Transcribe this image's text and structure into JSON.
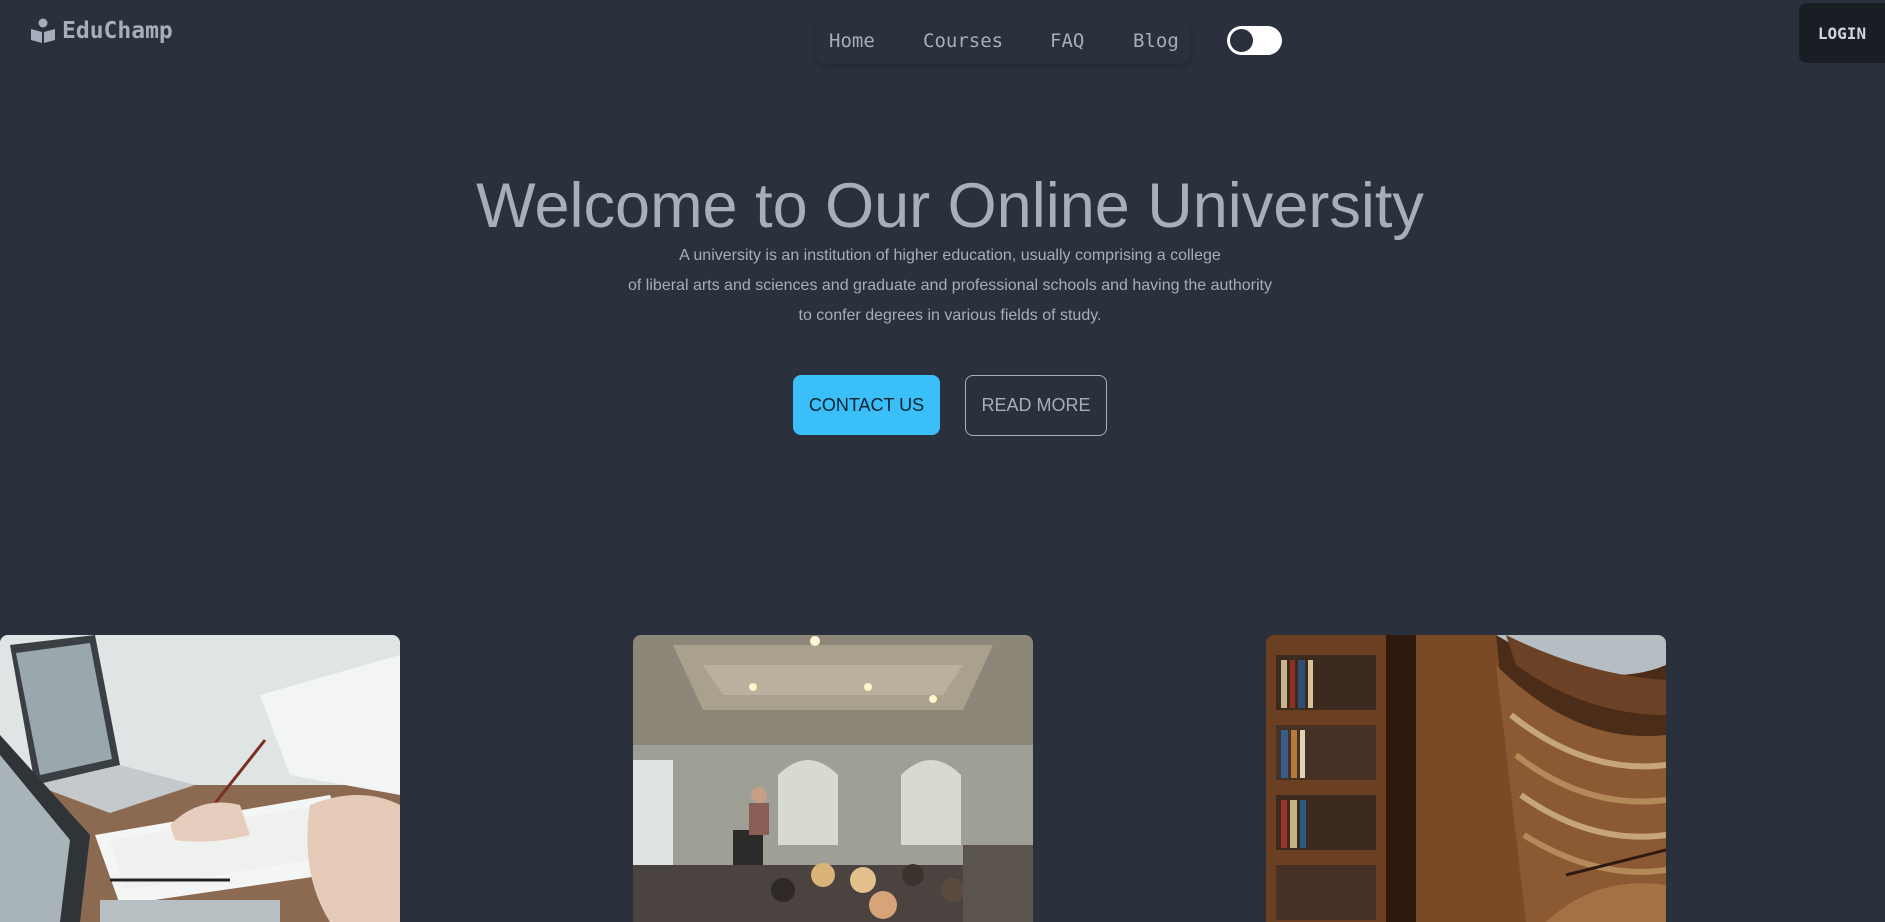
{
  "brand": {
    "name": "EduChamp",
    "icon": "book-reader-icon"
  },
  "nav": {
    "items": [
      {
        "label": "Home"
      },
      {
        "label": "Courses"
      },
      {
        "label": "FAQ"
      },
      {
        "label": "Blog"
      }
    ],
    "theme_toggle": {
      "state": "off"
    },
    "login_label": "LOGIN"
  },
  "hero": {
    "title": "Welcome to Our Online University",
    "description_lines": [
      "A university is an institution of higher education, usually comprising a college",
      "of liberal arts and sciences and graduate and professional schools and having the authority",
      "to confer degrees in various fields of study."
    ],
    "buttons": {
      "contact_label": "CONTACT US",
      "read_more_label": "READ MORE"
    }
  },
  "gallery": {
    "images": [
      {
        "subject": "laptop-and-paperwork-photo"
      },
      {
        "subject": "classroom-lecture-photo"
      },
      {
        "subject": "library-bookshelves-photo"
      }
    ]
  },
  "colors": {
    "background": "#2a303c",
    "text": "#a6adbb",
    "accent": "#3abff8",
    "login_bg": "#191e24"
  }
}
